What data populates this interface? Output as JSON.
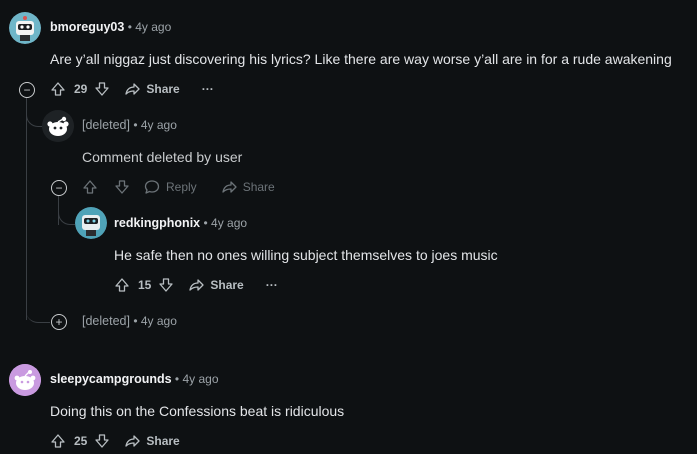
{
  "comments": [
    {
      "author": "bmoreguy03",
      "age": "4y ago",
      "body": "Are y’all niggaz just discovering his lyrics? Like there are way worse y’all are in for a rude awakening",
      "score": "29",
      "share": "Share",
      "more": "···",
      "collapse": "−"
    },
    {
      "author": "[deleted]",
      "age": "4y ago",
      "body": "Comment deleted by user",
      "reply": "Reply",
      "share": "Share",
      "collapse": "−"
    },
    {
      "author": "redkingphonix",
      "age": "4y ago",
      "body": "He safe then no ones willing subject themselves to joes music",
      "score": "15",
      "share": "Share",
      "more": "···"
    },
    {
      "author": "[deleted]",
      "age": "4y ago",
      "expand": "+"
    },
    {
      "author": "sleepycampgrounds",
      "age": "4y ago",
      "body": "Doing this on the Confessions beat is ridiculous",
      "score": "25",
      "share": "Share"
    }
  ],
  "sep": "•",
  "colors": {
    "bg": "#0e1113",
    "text": "#d7dadc",
    "muted": "#9ca3a8",
    "thread": "#3a3f44"
  },
  "icons": [
    "upvote-icon",
    "downvote-icon",
    "share-icon",
    "reply-icon",
    "more-icon",
    "snoo-icon"
  ]
}
